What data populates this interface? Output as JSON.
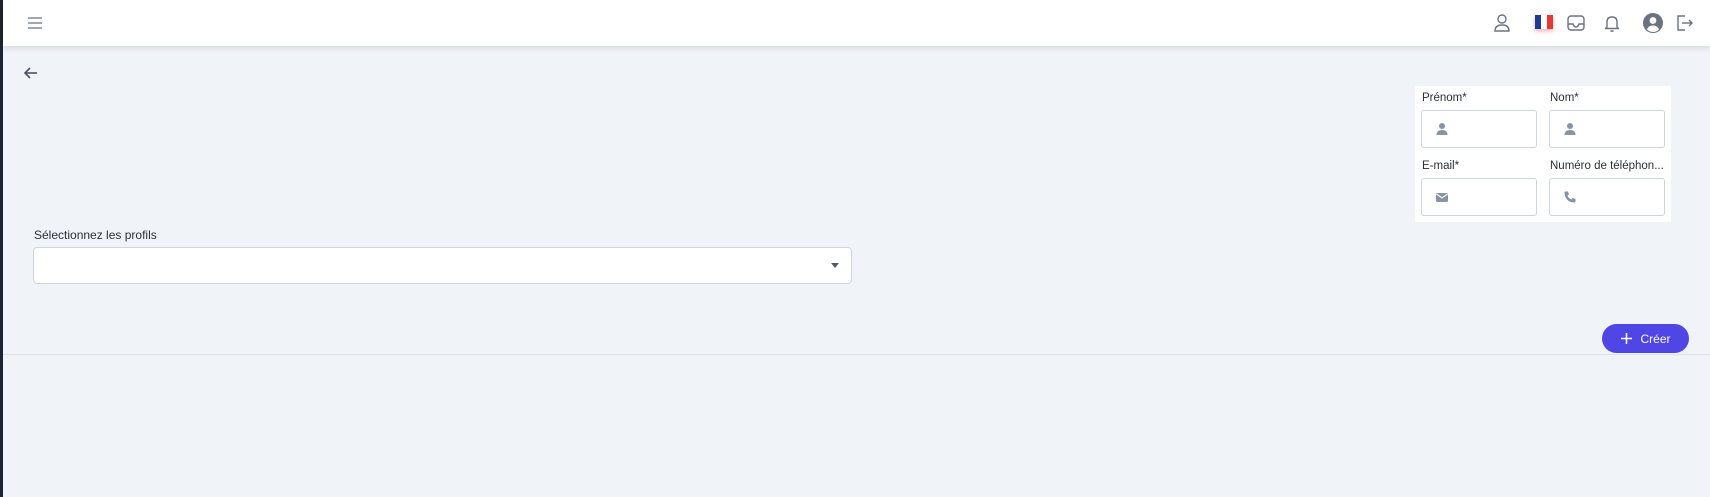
{
  "topbar": {
    "icons": [
      "menu-icon",
      "user-icon",
      "flag-fr-icon",
      "inbox-icon",
      "bell-icon",
      "account-circle-icon",
      "logout-icon"
    ],
    "flag_colors": [
      "#1f3a93",
      "#ffffff",
      "#e53935"
    ]
  },
  "form": {
    "first_name": {
      "label": "Prénom*",
      "value": "",
      "icon": "user-icon"
    },
    "last_name": {
      "label": "Nom*",
      "value": "",
      "icon": "user-icon"
    },
    "email": {
      "label": "E-mail*",
      "value": "",
      "icon": "envelope-icon"
    },
    "phone": {
      "label": "Numéro de téléphon...",
      "value": "",
      "icon": "phone-icon"
    }
  },
  "profiles": {
    "label": "Sélectionnez les profils",
    "value": ""
  },
  "actions": {
    "create_label": "Créer",
    "accent_color": "#4f46e5"
  }
}
